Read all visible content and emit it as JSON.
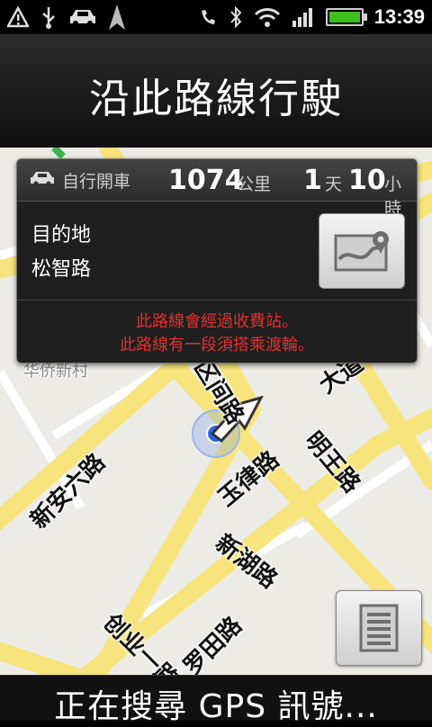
{
  "status_bar": {
    "icons_left": [
      "warning-icon",
      "usb-icon",
      "car-icon",
      "navigation-arrow-icon"
    ],
    "icons_right": [
      "mute-icon",
      "bluetooth-icon",
      "wifi-icon",
      "signal-icon",
      "battery-icon"
    ],
    "time": "13:39"
  },
  "title": "沿此路線行駛",
  "panel": {
    "mode_label": "自行開車",
    "distance_value": "1074",
    "distance_unit": "公里",
    "duration_days": "1",
    "duration_days_unit": "天",
    "duration_hours": "10",
    "duration_hours_unit": "小時",
    "destination_label": "目的地",
    "destination_name": "松智路",
    "warning_toll": "此路線會經過收費站。",
    "warning_ferry": "此路線有一段須搭乘渡輪。"
  },
  "map": {
    "labels": {
      "village": "华侨新村",
      "road_qujian": "区间路",
      "road_dadao": "大道",
      "road_xinanliu": "新安六路",
      "road_yulv": "玉律路",
      "road_mingwang": "明王路",
      "road_xinhu": "新湖路",
      "road_chuangye": "创业一路",
      "road_luotian": "罗田路"
    }
  },
  "footer": {
    "status_text": "正在搜尋 GPS 訊號..."
  },
  "colors": {
    "warning": "#e03030",
    "road": "#f7e47c",
    "map_bg": "#ecebe6",
    "location": "#2a66e0"
  }
}
